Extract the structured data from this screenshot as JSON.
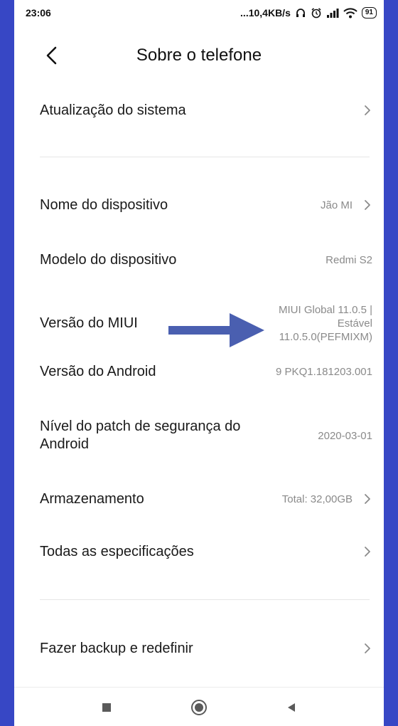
{
  "status_bar": {
    "time": "23:06",
    "net_speed": "...10,4KB/s",
    "battery": "91",
    "icons": [
      "headset-icon",
      "alarm-icon",
      "signal-icon",
      "wifi-icon",
      "battery-icon"
    ]
  },
  "header": {
    "title": "Sobre o telefone",
    "back_icon": "chevron-left-icon"
  },
  "rows": [
    {
      "label": "Atualização do sistema",
      "value": "",
      "chevron": true
    },
    {
      "label": "Nome do dispositivo",
      "value": "Jão MI",
      "chevron": true
    },
    {
      "label": "Modelo do dispositivo",
      "value": "Redmi S2",
      "chevron": false
    },
    {
      "label": "Versão do MIUI",
      "value_lines": [
        "MIUI Global 11.0.5 |",
        "Estável",
        "11.0.5.0(PEFMIXM)"
      ],
      "chevron": false
    },
    {
      "label": "Versão do Android",
      "value": "9 PKQ1.181203.001",
      "chevron": false
    },
    {
      "label_lines": [
        "Nível do patch de segurança do",
        "Android"
      ],
      "value": "2020-03-01",
      "chevron": false
    },
    {
      "label": "Armazenamento",
      "value": "Total: 32,00GB",
      "chevron": true
    },
    {
      "label": "Todas as especificações",
      "value": "",
      "chevron": true
    },
    {
      "label": "Fazer backup e redefinir",
      "value": "",
      "chevron": true
    }
  ],
  "nav_bar": {
    "buttons": [
      "recents-square-icon",
      "home-circle-icon",
      "back-triangle-icon"
    ]
  },
  "colors": {
    "background_frame": "#3747c5",
    "annotation_arrow": "#4a5fb0",
    "label_text": "#1a1a1a",
    "value_text": "#8a8a8a"
  }
}
